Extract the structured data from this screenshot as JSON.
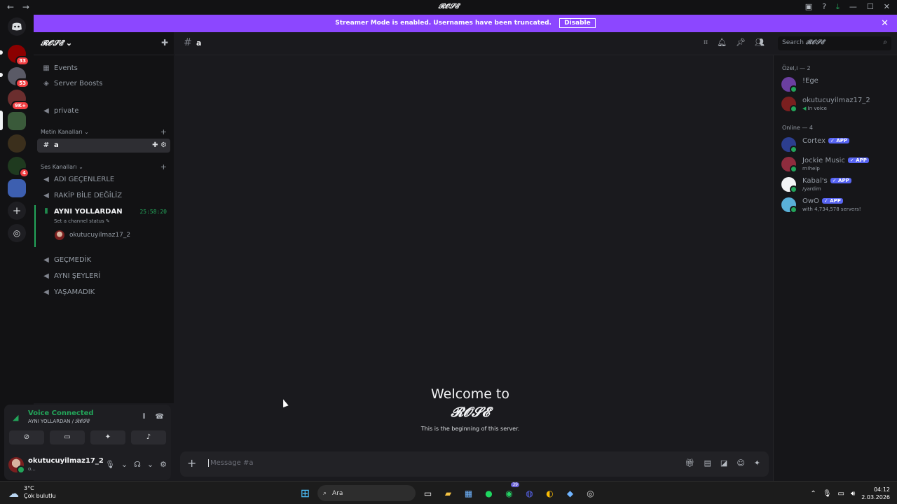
{
  "window": {
    "title": "𝓡𝓞𝓢𝓔",
    "back_icon": "←",
    "forward_icon": "→"
  },
  "banner": {
    "text": "Streamer Mode is enabled. Usernames have been truncated.",
    "button": "Disable"
  },
  "guilds": {
    "badges": [
      "33",
      "53",
      "9K+",
      "4"
    ]
  },
  "server": {
    "name": "𝓡𝓞𝓢𝓔",
    "chevron": "⌄",
    "nav": [
      {
        "label": "Events"
      },
      {
        "label": "Server Boosts"
      }
    ],
    "private_channel": "private",
    "text_category": "Metin Kanalları",
    "text_channels": [
      "a"
    ],
    "voice_category": "Ses Kanalları",
    "voice_channels_top": [
      "ADI GEÇENLERLE",
      "RAKİP BİLE DEĞİLİZ"
    ],
    "live_channel": {
      "name": "AYNI YOLLARDAN",
      "timer": "25:58:20",
      "status_hint": "Set a channel status",
      "user": "okutucuyilmaz17_2"
    },
    "voice_channels_bottom": [
      "GEÇMEDİK",
      "AYNI ŞEYLERİ",
      "YAŞAMADIK"
    ]
  },
  "voice_panel": {
    "title": "Voice Connected",
    "subtitle": "AYNI YOLLARDAN / 𝓡𝓞𝓢𝓔"
  },
  "user": {
    "name": "okutucuyilmaz17_2",
    "status": "o..."
  },
  "chat": {
    "channel": "a",
    "search_label": "Search",
    "search_server": "𝓡𝓞𝓢𝓔",
    "welcome_line1": "Welcome to",
    "welcome_line2": "𝓡𝓞𝓢𝓔",
    "welcome_sub": "This is the beginning of this server.",
    "composer_placeholder": "Message #a"
  },
  "members": {
    "group1": "Özel,i — 2",
    "group2": "Online — 4",
    "app_tag": "✓ APP",
    "list1": [
      {
        "name": "!Ege",
        "sub": "",
        "color": "#6b3fa0"
      },
      {
        "name": "okutucuyilmaz17_2",
        "sub": "In voice",
        "color": "#7a1f1f"
      }
    ],
    "list2": [
      {
        "name": "Cortex",
        "sub": "",
        "color": "#2c3e8f"
      },
      {
        "name": "Jockie Music",
        "sub": "m!help",
        "color": "#8f2c3e"
      },
      {
        "name": "Kabal's",
        "sub": "/yardim",
        "color": "#f2f3f5"
      },
      {
        "name": "OwO",
        "sub": "with 4,734,578 servers!",
        "color": "#5ab0d8"
      }
    ]
  },
  "taskbar": {
    "temp": "3°C",
    "weather": "Çok bulutlu",
    "search": "Ara",
    "whatsapp_badge": "39",
    "time": "04:12",
    "date": "2.03.2026"
  },
  "colors": {
    "accent": "#5865f2",
    "banner": "#8c47ff",
    "online": "#23a55a",
    "danger": "#f23f43"
  }
}
